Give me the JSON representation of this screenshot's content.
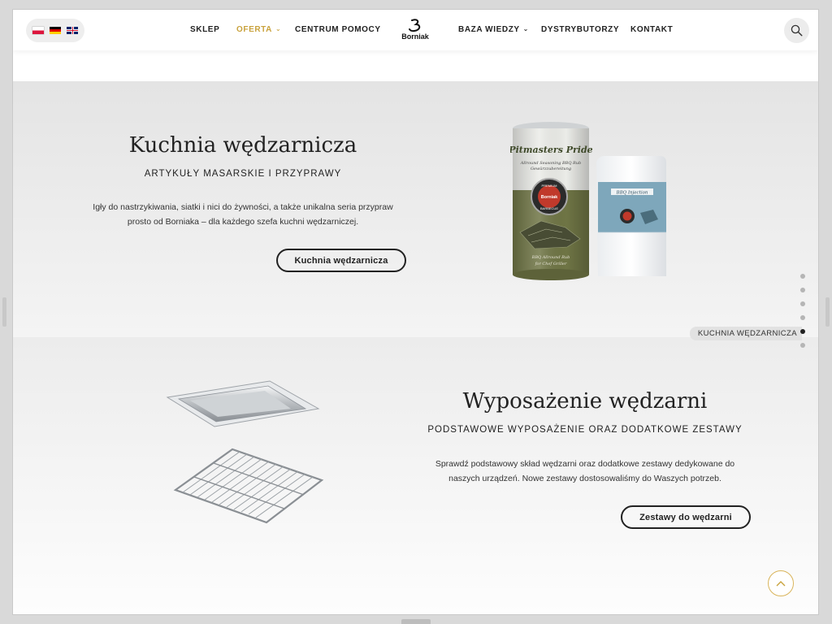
{
  "header": {
    "languages": [
      {
        "code": "pl",
        "icon": "flag-poland-icon"
      },
      {
        "code": "de",
        "icon": "flag-germany-icon"
      },
      {
        "code": "en",
        "icon": "flag-uk-icon"
      }
    ],
    "nav_left": [
      {
        "label": "SKLEP",
        "active": false
      },
      {
        "label": "OFERTA",
        "active": true,
        "dropdown": true
      },
      {
        "label": "CENTRUM POMOCY",
        "active": false
      }
    ],
    "logo_text": "Borniak",
    "nav_right": [
      {
        "label": "BAZA WIEDZY",
        "active": false,
        "dropdown": true
      },
      {
        "label": "DYSTRYBUTORZY",
        "active": false
      },
      {
        "label": "KONTAKT",
        "active": false
      }
    ],
    "search_icon": "search-icon"
  },
  "section1": {
    "title": "Kuchnia wędzarnicza",
    "subtitle": "ARTYKUŁY MASARSKIE I PRZYPRAWY",
    "description": "Igły do nastrzykiwania, siatki i nici do żywności, a także unikalna seria przypraw prosto od Borniaka – dla każdego szefa kuchni wędzarniczej.",
    "button": "Kuchnia wędzarnicza",
    "product": {
      "can_brand": "Pitmasters Pride",
      "can_line1": "Allround Seasoning BBQ Rub",
      "can_line2": "Gewürzzubereitung",
      "can_badge": "PREMIUM",
      "can_badge_brand": "Borniak",
      "can_badge_bottom": "BARBECUE",
      "can_bottom1": "BBQ Allround Rub",
      "can_bottom2": "for Chef Griller",
      "pouch_label": "BBQ Injection"
    }
  },
  "section2": {
    "title": "Wyposażenie wędzarni",
    "subtitle": "PODSTAWOWE WYPOSAŻENIE ORAZ DODATKOWE ZESTAWY",
    "description": "Sprawdź podstawowy skład wędzarni oraz dodatkowe zestawy dedykowane do naszych urządzeń. Nowe zestawy dostosowaliśmy do Waszych potrzeb.",
    "button": "Zestawy do wędzarni"
  },
  "page_nav": {
    "active_index": 4,
    "active_label": "KUCHNIA WĘDZARNICZA",
    "count": 6
  },
  "colors": {
    "accent": "#c9a23c",
    "text": "#222222",
    "can_green": "#6f7545",
    "pouch_blue": "#7ea7bb"
  },
  "back_to_top_icon": "chevron-up-icon"
}
